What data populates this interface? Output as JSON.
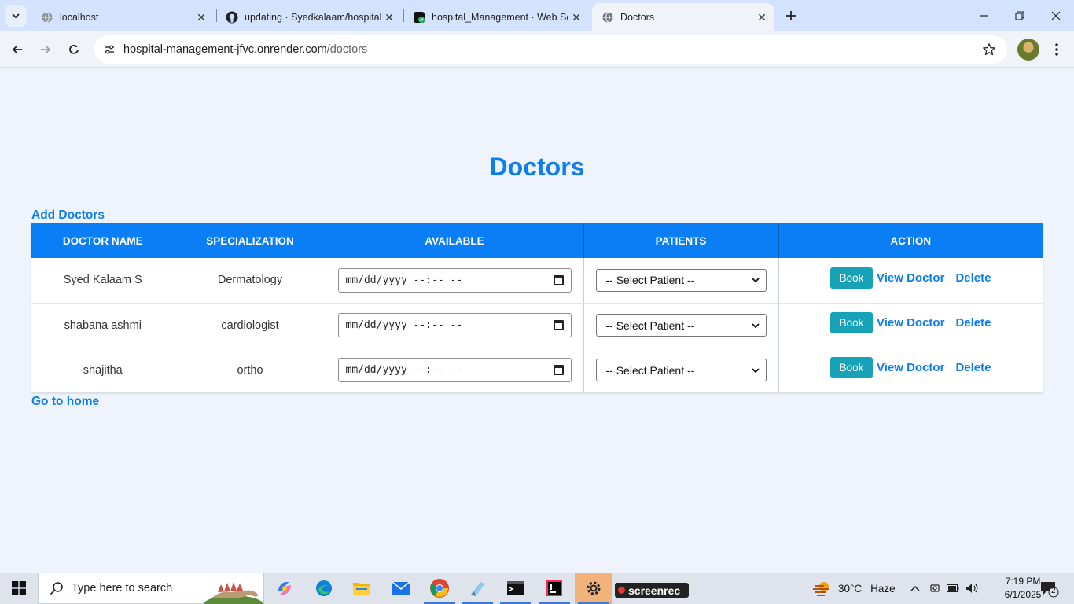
{
  "browser": {
    "tabs": [
      {
        "title": "localhost",
        "icon": "globe-icon",
        "active": false
      },
      {
        "title": "updating · Syedkalaam/hospital",
        "icon": "github-icon",
        "active": false
      },
      {
        "title": "hospital_Management · Web Se",
        "icon": "render-icon",
        "active": false
      },
      {
        "title": "Doctors",
        "icon": "globe-icon",
        "active": true
      }
    ],
    "url_host": "hospital-management-jfvc.onrender.com",
    "url_path": "/doctors"
  },
  "page": {
    "title": "Doctors",
    "add_link": "Add Doctors",
    "home_link": "Go to home",
    "table": {
      "headers": [
        "DOCTOR NAME",
        "SPECIALIZATION",
        "AVAILABLE",
        "PATIENTS",
        "ACTION"
      ],
      "rows": [
        {
          "name": "Syed Kalaam S",
          "specialization": "Dermatology",
          "available": "mm/dd/yyyy --:-- --",
          "patient": "-- Select Patient --"
        },
        {
          "name": "shabana ashmi",
          "specialization": "cardiologist",
          "available": "mm/dd/yyyy --:-- --",
          "patient": "-- Select Patient --"
        },
        {
          "name": "shajitha",
          "specialization": "ortho",
          "available": "mm/dd/yyyy --:-- --",
          "patient": "-- Select Patient --"
        }
      ],
      "actions": {
        "book": "Book",
        "view": "View Doctor",
        "delete": "Delete"
      }
    }
  },
  "taskbar": {
    "search_placeholder": "Type here to search",
    "weather": {
      "temp": "30°C",
      "condition": "Haze"
    },
    "time": "7:19 PM",
    "date": "6/1/2025",
    "screenrec_label": "screenrec",
    "notification_count": "2"
  },
  "colors": {
    "accent": "#0d7ef2",
    "header_bg": "#0a7ff5",
    "book_button": "#17a2b8",
    "page_bg": "#eff3fb"
  }
}
